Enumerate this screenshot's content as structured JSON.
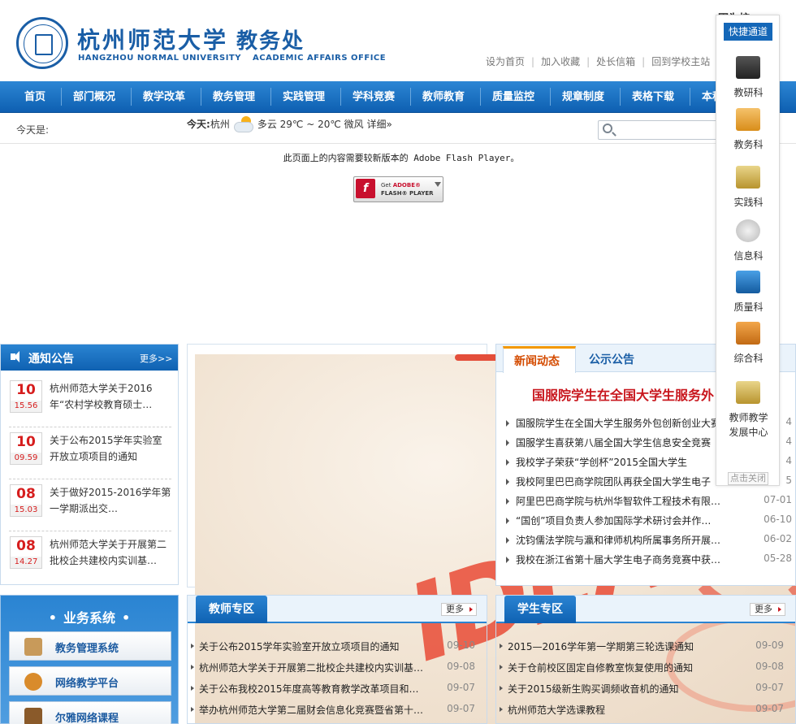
{
  "header": {
    "logo_cn": "杭州师范大学",
    "office_cn": "教务处",
    "logo_en": "HANGZHOU NORMAL UNIVERSITY",
    "office_en": "ACADEMIC AFFAIRS OFFICE",
    "top_links": [
      "设为首页",
      "加入收藏",
      "处长信箱",
      "回到学校主站"
    ],
    "cut_text": "因为校"
  },
  "nav": {
    "items": [
      "首页",
      "部门概况",
      "教学改革",
      "教务管理",
      "实践管理",
      "学科竞赛",
      "教师教育",
      "质量监控",
      "规章制度",
      "表格下载",
      "本科"
    ]
  },
  "status": {
    "today_label": "今天是:",
    "weather_label": "今天:",
    "weather_city": "杭州",
    "weather_desc": "多云 29℃ ~ 20℃ 微风 详细»"
  },
  "flash": {
    "message": "此页面上的内容需要较新版本的 Adobe Flash Player。",
    "btn_line1_a": "Get ",
    "btn_line1_b": "ADOBE®",
    "btn_line2": "FLASH® PLAYER",
    "logo_glyph": "f"
  },
  "notice": {
    "title": "通知公告",
    "more": "更多>>",
    "items": [
      {
        "day": "10",
        "time": "15.56",
        "text": "杭州师范大学关于2016年“农村学校教育硕士…"
      },
      {
        "day": "10",
        "time": "09.59",
        "text": "关于公布2015学年实验室开放立项项目的通知"
      },
      {
        "day": "08",
        "time": "15.03",
        "text": "关于做好2015-2016学年第一学期派出交…"
      },
      {
        "day": "08",
        "time": "14.27",
        "text": "杭州师范大学关于开展第二批校企共建校内实训基…"
      }
    ]
  },
  "business": {
    "title": "业务系统",
    "items": [
      "教务管理系统",
      "网络教学平台",
      "尔雅网络课程"
    ]
  },
  "banner": {
    "word": "IDEA"
  },
  "news": {
    "tab_active": "新闻动态",
    "tab_other": "公示公告",
    "headline": "国服院学生在全国大学生服务外",
    "items": [
      {
        "title": "国服院学生在全国大学生服务外包创新创业大赛",
        "date": "4"
      },
      {
        "title": "国服学生喜获第八届全国大学生信息安全竞赛",
        "date": "4"
      },
      {
        "title": "我校学子荣获“学创杯”2015全国大学生",
        "date": "4"
      },
      {
        "title": "我校阿里巴巴商学院团队再获全国大学生电子",
        "date": "5"
      },
      {
        "title": "阿里巴巴商学院与杭州华智软件工程技术有限…",
        "date": "07-01"
      },
      {
        "title": "“国创”项目负责人参加国际学术研讨会并作…",
        "date": "06-10"
      },
      {
        "title": "沈钧儒法学院与瀛和律师机构所属事务所开展…",
        "date": "06-02"
      },
      {
        "title": "我校在浙江省第十届大学生电子商务竞赛中获…",
        "date": "05-28"
      }
    ]
  },
  "teacher": {
    "title": "教师专区",
    "more": "更多",
    "items": [
      {
        "title": "关于公布2015学年实验室开放立项项目的通知",
        "date": "09-10"
      },
      {
        "title": "杭州师范大学关于开展第二批校企共建校内实训基…",
        "date": "09-08"
      },
      {
        "title": "关于公布我校2015年度高等教育教学改革项目和…",
        "date": "09-07"
      },
      {
        "title": "举办杭州师范大学第二届财会信息化竞赛暨省第十…",
        "date": "09-07"
      }
    ]
  },
  "student": {
    "title": "学生专区",
    "more": "更多",
    "items": [
      {
        "title": "2015—2016学年第一学期第三轮选课通知",
        "date": "09-09"
      },
      {
        "title": "关于仓前校区固定自修教室恢复使用的通知",
        "date": "09-08"
      },
      {
        "title": "关于2015级新生购买调频收音机的通知",
        "date": "09-07"
      },
      {
        "title": "杭州师范大学选课教程",
        "date": "09-07"
      }
    ]
  },
  "quick": {
    "title": "快捷通道",
    "items": [
      "教研科",
      "教务科",
      "实践科",
      "信息科",
      "质量科",
      "综合科",
      "教师教学发展中心"
    ],
    "close": "点击关闭"
  }
}
